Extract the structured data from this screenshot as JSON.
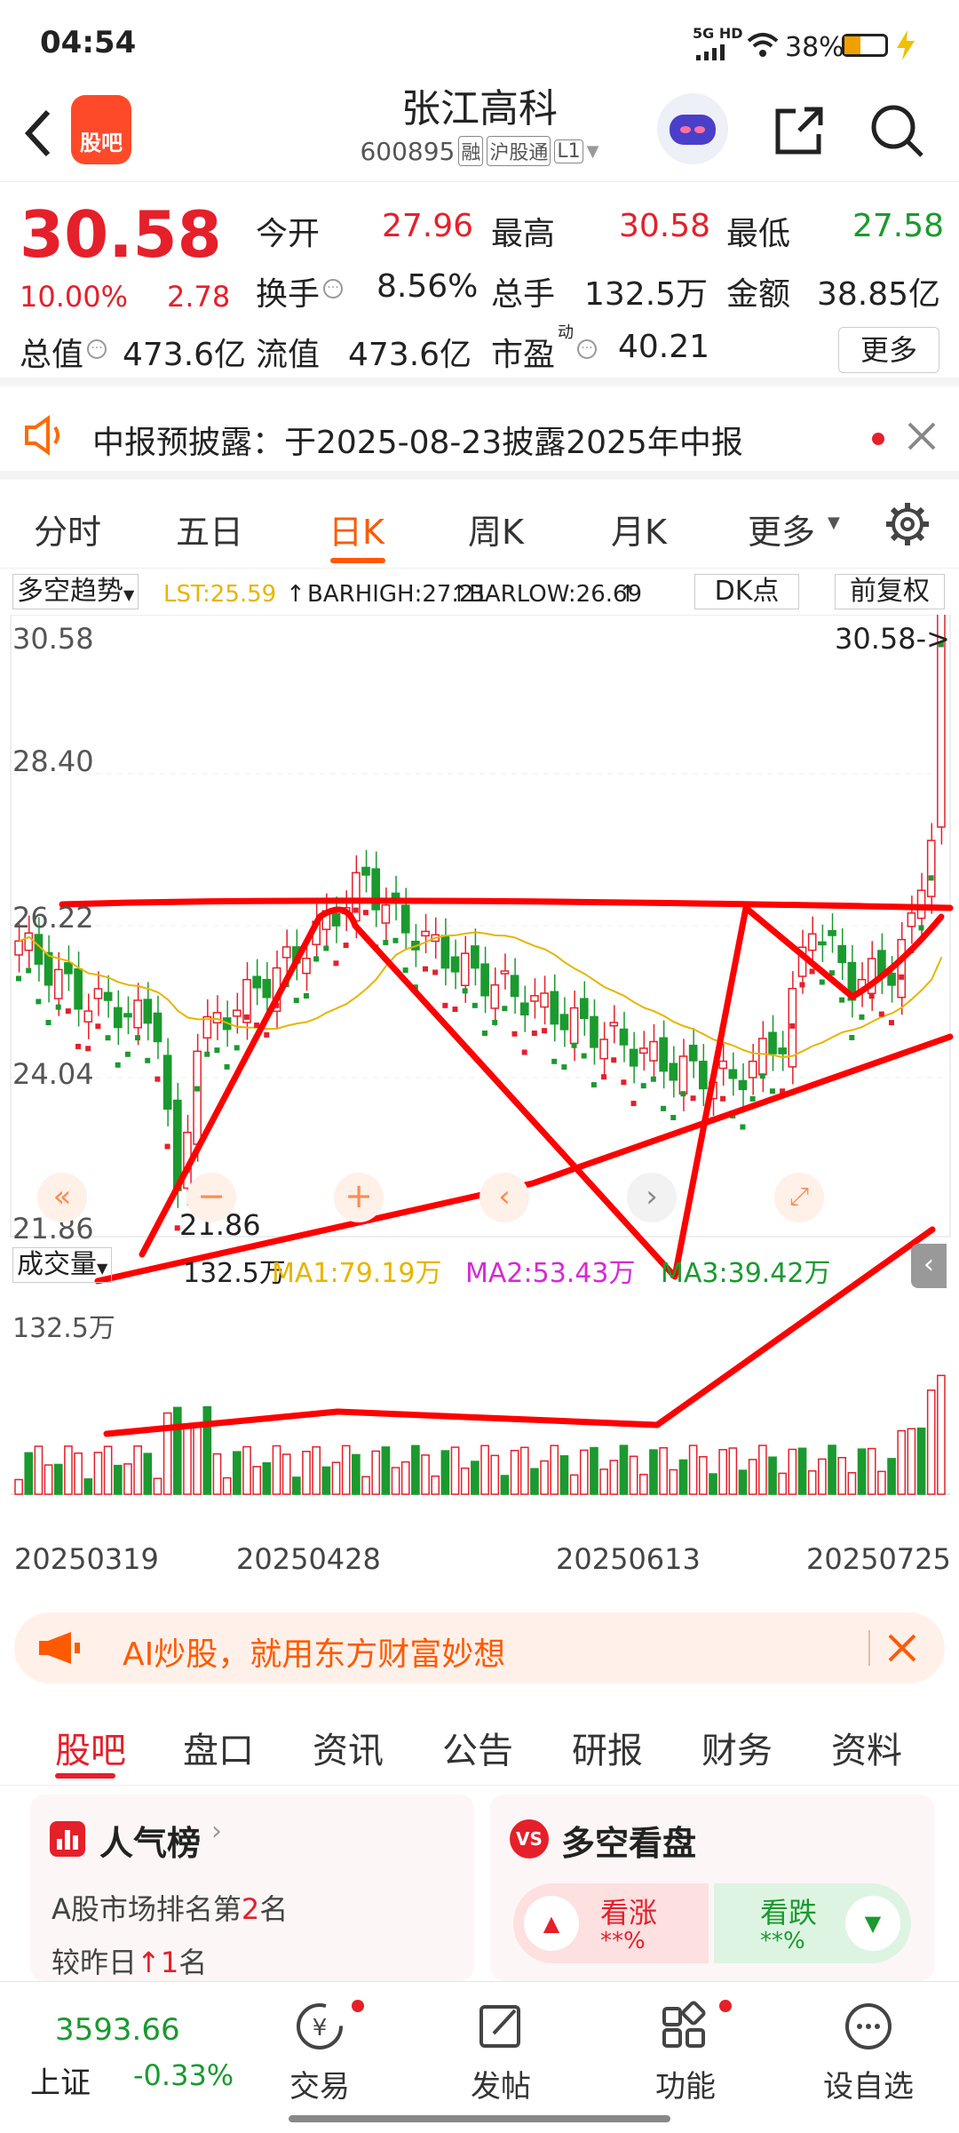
{
  "status_bar": {
    "time": "04:54",
    "network": "5G HD",
    "battery": "38%"
  },
  "header": {
    "logo_text": "股吧",
    "stock_name": "张江高科",
    "stock_code": "600895",
    "tag_margin": "融",
    "tag_connect": "沪股通",
    "tag_level": "L1"
  },
  "quote": {
    "price": "30.58",
    "change_pct": "10.00%",
    "change_abs": "2.78",
    "open_label": "今开",
    "open": "27.96",
    "high_label": "最高",
    "high": "30.58",
    "low_label": "最低",
    "low": "27.58",
    "turnover_label": "换手",
    "turnover": "8.56%",
    "volume_label": "总手",
    "volume": "132.5万",
    "amount_label": "金额",
    "amount": "38.85亿",
    "mcap_label": "总值",
    "mcap": "473.6亿",
    "float_label": "流值",
    "float": "473.6亿",
    "pe_label": "市盈",
    "pe_sup": "动",
    "pe": "40.21",
    "more_button": "更多"
  },
  "notice": {
    "text": "中报预披露：于2025-08-23披露2025年中报"
  },
  "chart_tabs": [
    "分时",
    "五日",
    "日K",
    "周K",
    "月K",
    "更多"
  ],
  "chart_tab_active": 2,
  "chart": {
    "indicator_name": "多空趋势",
    "lst": "LST:25.59",
    "barhigh": "BARHIGH:27.21",
    "barlow": "BARLOW:26.69",
    "dk_button": "DK点",
    "adjust_button": "前复权",
    "price_ticks": [
      "30.58",
      "28.40",
      "26.22",
      "24.04",
      "21.86"
    ],
    "last_price_label": "30.58->",
    "low_marker": "21.86",
    "volume_label": "成交量",
    "volume_value": "132.5万",
    "ma1": "MA1:79.19万",
    "ma2": "MA2:53.43万",
    "ma3": "MA3:39.42万",
    "volume_tick": "132.5万",
    "dates": [
      "20250319",
      "20250428",
      "20250613",
      "20250725"
    ]
  },
  "banner": {
    "text": "AI炒股，就用东方财富妙想"
  },
  "bottom_tabs": [
    "股吧",
    "盘口",
    "资讯",
    "公告",
    "研报",
    "财务",
    "资料"
  ],
  "bottom_tab_active": 0,
  "popularity": {
    "title": "人气榜",
    "rank_prefix": "A股市场排名第",
    "rank": "2",
    "rank_suffix": "名",
    "change_prefix": "较昨日",
    "change": "1",
    "change_suffix": "名"
  },
  "vs": {
    "title": "多空看盘",
    "up_label": "看涨",
    "up_value": "**%",
    "down_label": "看跌",
    "down_value": "**%"
  },
  "bottom_nav": {
    "index_value": "3593.66",
    "index_name": "上证",
    "index_change": "-0.33%",
    "items": [
      "交易",
      "发帖",
      "功能",
      "设自选"
    ]
  },
  "colors": {
    "up": "#e5202a",
    "down": "#1a9a2f",
    "accent": "#ff5a00",
    "ma1": "#e8b400",
    "ma2": "#d42bd4",
    "ma3": "#1a9a2f"
  }
}
